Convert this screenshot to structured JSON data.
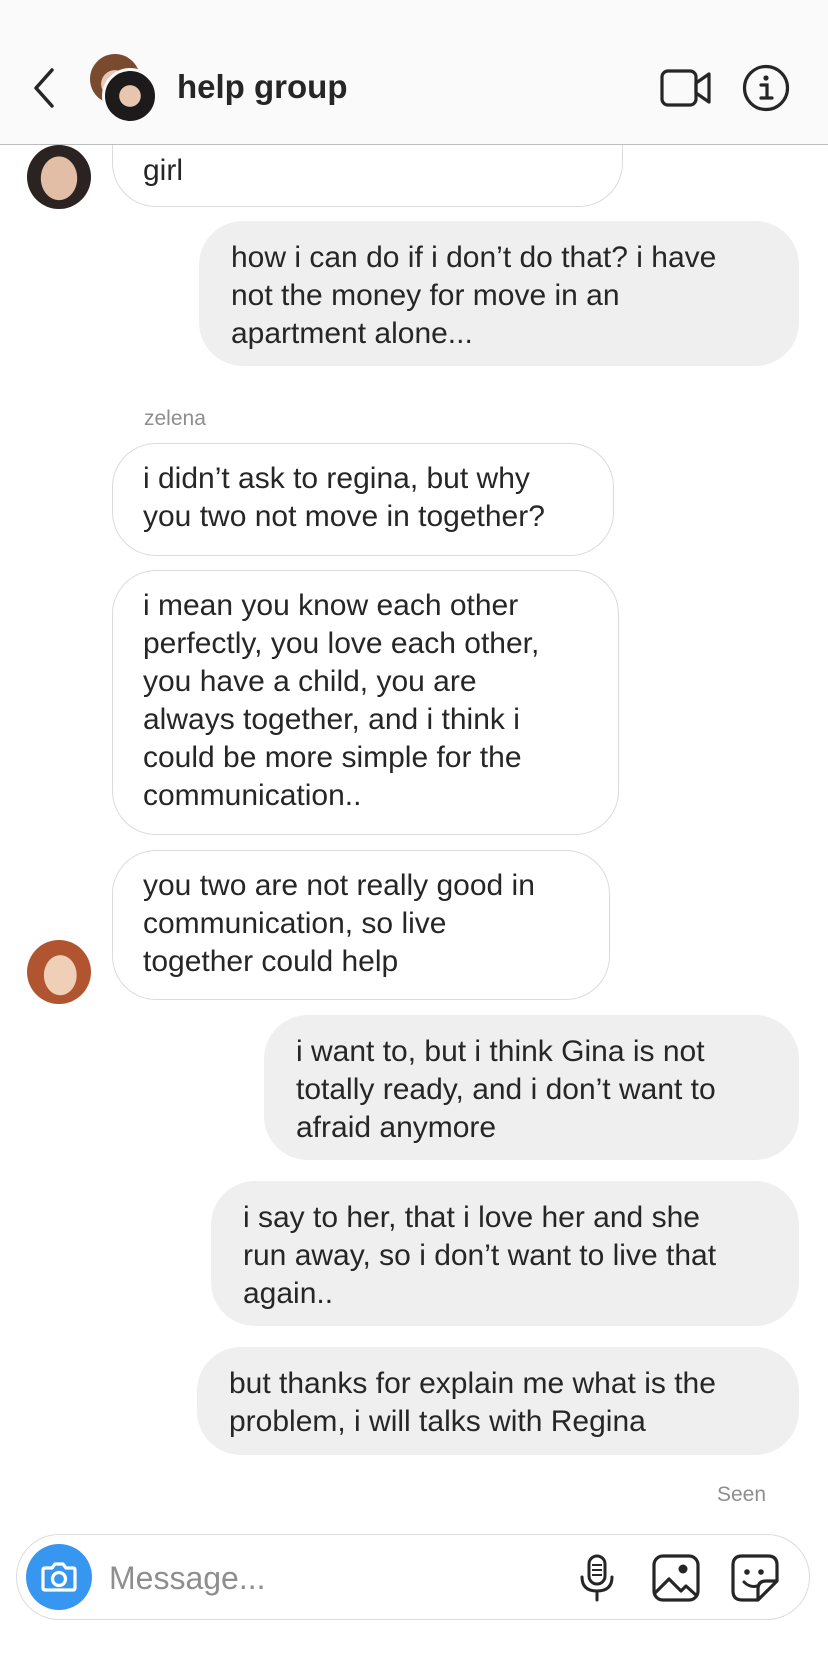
{
  "header": {
    "title": "help group"
  },
  "messages": [
    {
      "direction": "in",
      "text": "girl"
    },
    {
      "direction": "out",
      "text": "how i can do if i don’t do that? i have\nnot the money for move in an\napartment alone..."
    },
    {
      "direction": "in",
      "sender": "zelena",
      "text": "i didn’t ask to regina, but why\nyou two not move in together?"
    },
    {
      "direction": "in",
      "text": "i mean you know each other\nperfectly, you love each other,\nyou have a child, you are\nalways together, and i think i\ncould be more simple for the\ncommunication.."
    },
    {
      "direction": "in",
      "text": "you two are not really good in\ncommunication, so live\ntogether could help"
    },
    {
      "direction": "out",
      "text": "i want to, but i think Gina is not\ntotally ready, and i don’t want to\nafraid anymore"
    },
    {
      "direction": "out",
      "text": "i say to her, that i love her and she\nrun away, so i don’t want to live that\nagain.."
    },
    {
      "direction": "out",
      "text": "but thanks for explain me what is the\nproblem, i will talks with Regina"
    }
  ],
  "status": {
    "seen_label": "Seen"
  },
  "composer": {
    "placeholder": "Message..."
  },
  "icons": {
    "back": "chevron-left-icon",
    "video": "video-camera-icon",
    "info": "info-icon",
    "camera": "camera-icon",
    "mic": "microphone-icon",
    "gallery": "image-icon",
    "sticker": "sticker-icon"
  },
  "colors": {
    "accent": "#3797f0",
    "outgoing_bubble": "#efefef",
    "incoming_border": "#dbdbdb",
    "meta_text": "#8e8e8e"
  }
}
